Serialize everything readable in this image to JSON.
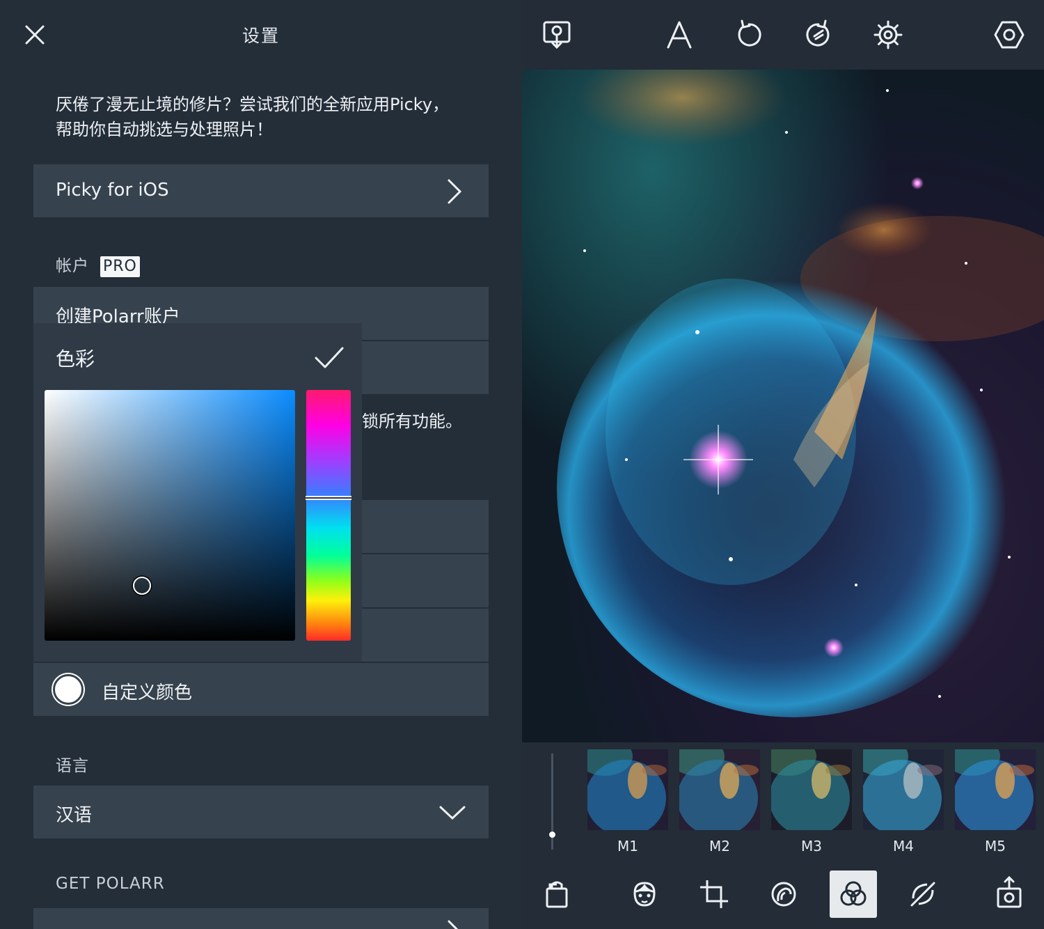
{
  "settings": {
    "title": "设置",
    "promo_line1": "厌倦了漫无止境的修片？尝试我们的全新应用Picky，",
    "promo_line2": "帮助你自动挑选与处理照片！",
    "picky_row": "Picky for iOS",
    "account_section": "帐户",
    "pro_badge": "PRO",
    "create_account": "创建Polarr账户",
    "unlock_text_fragment": "锁所有功能。",
    "custom_color": "自定义颜色",
    "language_section": "语言",
    "language_value": "汉语",
    "get_polarr_section": "GET POLARR"
  },
  "color_picker": {
    "title": "色彩",
    "selected_color": "#0a8cff",
    "saturation": 0.39,
    "brightness": 0.22,
    "hue_position": 0.43
  },
  "editor": {
    "top_icons": [
      "import-photo-icon",
      "text-icon",
      "undo-icon",
      "redo-icon",
      "settings-gear-icon",
      "options-hexagon-icon"
    ],
    "filters": [
      "M1",
      "M2",
      "M3",
      "M4",
      "M5"
    ],
    "bottom_icons": [
      "filters-bag-icon",
      "face-icon",
      "crop-icon",
      "retouch-icon",
      "color-circles-icon",
      "brush-icon",
      "export-icon"
    ],
    "active_tool": "color-circles-icon"
  }
}
